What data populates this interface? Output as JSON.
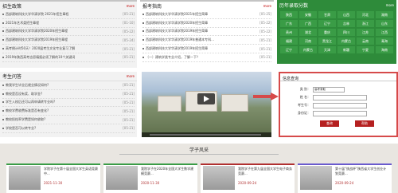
{
  "admissions": {
    "title": "招生政策",
    "more": "more",
    "items": [
      {
        "text": "西部建筑科技大学华清学院 2021年招生章程",
        "date": "[05-21]"
      },
      {
        "text": "2021年艺术类招生章程",
        "date": "[01-10]"
      },
      {
        "text": "西部建筑科技大学华清学院2020年招生章程",
        "date": "[05-22]"
      },
      {
        "text": "西部建筑科技大学华清学院2019年招生章程",
        "date": "[05-24]"
      },
      {
        "text": "高考倒计时50天！2020届考生文化专业复习了解",
        "date": "[05-21]"
      },
      {
        "text": "2019年陕西高考志愿填报必须了解的10个关键词",
        "date": "[05-21]"
      }
    ]
  },
  "guide": {
    "title": "报考指南",
    "more": "more",
    "items": [
      {
        "text": "西部建筑科技大学华清学院2021年招生简章",
        "date": "[05-25]"
      },
      {
        "text": "西部建筑科技大学华清学院2020年招生简章",
        "date": "[05-22]"
      },
      {
        "text": "西部建筑科技大学华清学院2019年招生简章",
        "date": "[05-22]"
      },
      {
        "text": "西部建筑科技大学华清学院2019年普通本专科...",
        "date": "[05-21]"
      },
      {
        "text": "西部建筑科技大学华清学院2019年招生简章",
        "date": "[05-21]"
      },
      {
        "text": "（一）建筑学类专业介绍，了解一下？",
        "date": "[05-21]"
      }
    ]
  },
  "scores": {
    "title": "历年录取分数",
    "more": "more",
    "provinces": [
      "陕西",
      "安徽",
      "甘肃",
      "山西",
      "河北",
      "湖南",
      "广东",
      "广西",
      "辽宁",
      "吉林",
      "浙江",
      "山东",
      "贵州",
      "湖北",
      "重庆",
      "四川",
      "江苏",
      "江西",
      "福建",
      "河南",
      "黑龙江",
      "内蒙古",
      "云南",
      "青海",
      "辽宁",
      "内蒙古",
      "天津",
      "新疆",
      "宁夏",
      "海南"
    ]
  },
  "qa": {
    "title": "考生问答",
    "more": "more",
    "items": [
      {
        "text": "教我学生毕业后就业情况如何?",
        "date": "[05-21]"
      },
      {
        "text": "教校是否设有奖、助学金?",
        "date": "[05-21]"
      },
      {
        "text": "学生入校后还可以再申请转专业吗?",
        "date": "[05-21]"
      },
      {
        "text": "教校学费收费标准是否有变化?",
        "date": "[05-21]"
      },
      {
        "text": "教校投档率学费是如何收取?",
        "date": "[05-21]"
      },
      {
        "text": "学校是否可以转专业?",
        "date": "[05-21]"
      }
    ]
  },
  "query": {
    "title": "信息查询",
    "type_label": "类   别：",
    "type_value": "高考录取",
    "name_label": "姓   名：",
    "exam_label": "考生号：",
    "id_label": "身份证：",
    "search_btn": "查询",
    "help_btn": "帮助"
  },
  "style_section": {
    "title": "学子风采",
    "cards": [
      {
        "title": "学院学子在第十届全国大学生英语竞赛中...",
        "date": "2021-11-30",
        "color": "#3a9c46"
      },
      {
        "title": "我院学子在2020年全国大学生数学建模竞赛...",
        "date": "2020-11-30",
        "color": "#3a9c46"
      },
      {
        "title": "我院学子在第九届全国大学生电子商务竞赛...",
        "date": "2020-09-24",
        "color": "#b03030"
      },
      {
        "title": "第十届“挑战杯”陕西省大学生创业计划竞赛...",
        "date": "2020-09-24",
        "color": "#6a5acd"
      }
    ]
  },
  "colors": {
    "accent": "#c00000",
    "green": "#2e8b3a",
    "red_border": "#d64a4a"
  }
}
